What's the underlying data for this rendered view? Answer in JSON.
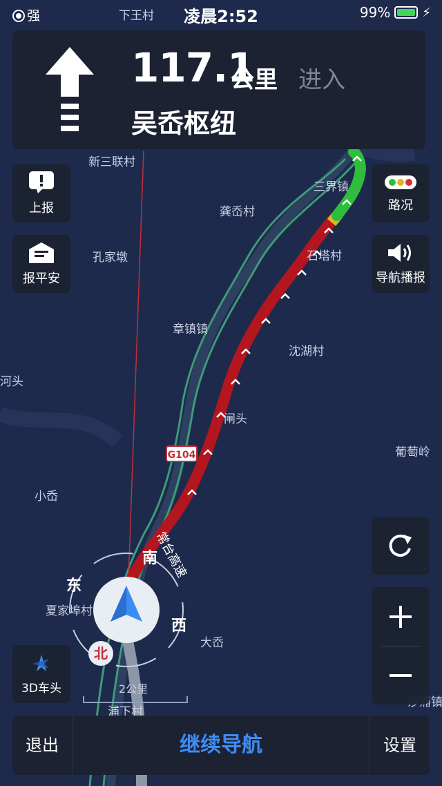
{
  "status": {
    "signal_text": "强",
    "time": "凌晨2:52",
    "battery": "99%",
    "battery_level": 0.99
  },
  "guidance": {
    "distance": "117.1",
    "unit": "公里",
    "action": "进入",
    "road": "吴岙枢纽"
  },
  "left_buttons": {
    "report": "上报",
    "safe": "报平安",
    "mode_3d": "3D车头"
  },
  "right_buttons": {
    "traffic": "路况",
    "voice": "导航播报"
  },
  "map_labels": {
    "xinsanlian": "新三联村",
    "sanjie": "三界镇",
    "gongao": "龚岙村",
    "kongjiadun": "孔家墩",
    "shitacun": "石塔村",
    "zhangzhen": "章镇镇",
    "shenhu": "沈湖村",
    "hetou": "河头",
    "zhatou": "闸头",
    "g104": "G104",
    "putaoling": "葡萄岭",
    "xiaoao": "小岙",
    "xiajiafu": "夏家埠村",
    "daao": "大岙",
    "highway": "常台高速",
    "pujiang": "浦下村",
    "xiawangtop": "下王村",
    "yushan": "沙浦镇"
  },
  "compass": {
    "south": "南",
    "east": "东",
    "west": "西",
    "north": "北"
  },
  "scale": "2公里",
  "bottom": {
    "exit": "退出",
    "continue": "继续导航",
    "settings": "设置"
  },
  "colors": {
    "route_red": "#b3161e",
    "route_green": "#2fbe3b",
    "accent_blue": "#3d8cf5",
    "panel": "#1c2231",
    "map_bg": "#1d2a4c"
  }
}
